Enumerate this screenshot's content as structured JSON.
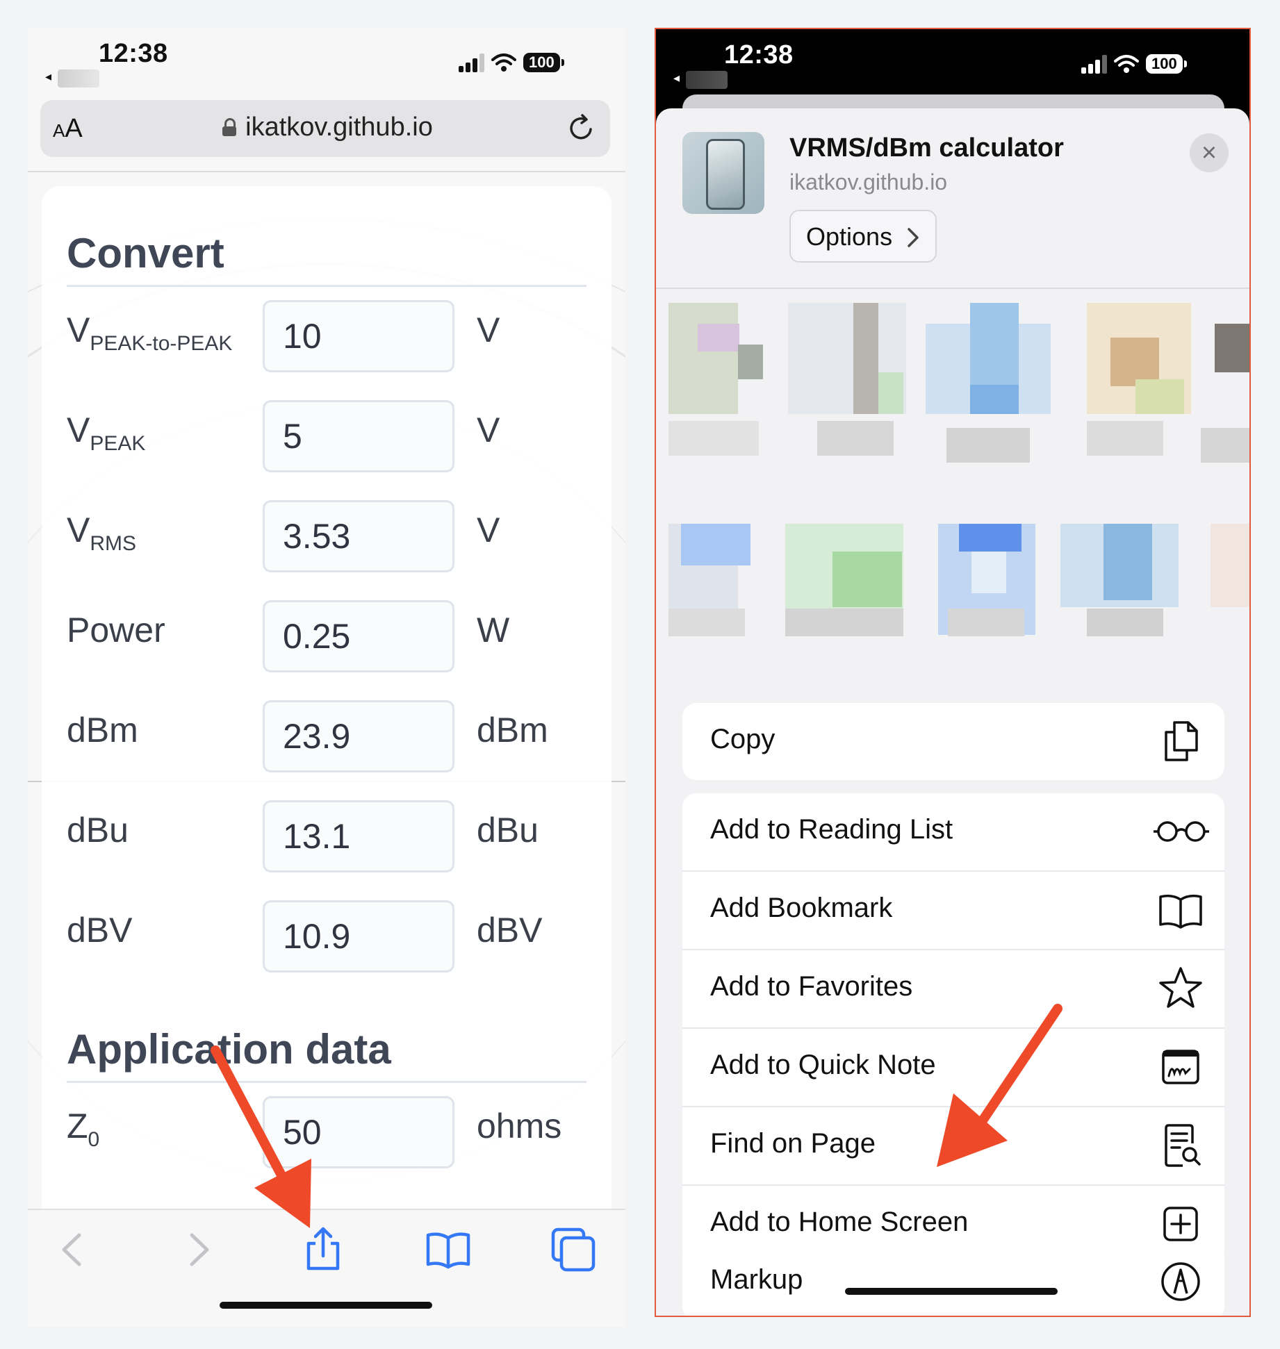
{
  "left": {
    "status": {
      "time": "12:38",
      "back_app": "◂",
      "battery": "100"
    },
    "url_bar": {
      "aa_big": "A",
      "aa_small": "A",
      "domain": "ikatkov.github.io"
    },
    "convert": {
      "heading": "Convert",
      "rows": [
        {
          "label_main": "V",
          "label_sub": "PEAK-to-PEAK",
          "value": "10",
          "unit": "V"
        },
        {
          "label_main": "V",
          "label_sub": "PEAK",
          "value": "5",
          "unit": "V"
        },
        {
          "label_main": "V",
          "label_sub": "RMS",
          "value": "3.53",
          "unit": "V"
        },
        {
          "label_main": "Power",
          "label_sub": "",
          "value": "0.25",
          "unit": "W"
        },
        {
          "label_main": "dBm",
          "label_sub": "",
          "value": "23.9",
          "unit": "dBm"
        },
        {
          "label_main": "dBu",
          "label_sub": "",
          "value": "13.1",
          "unit": "dBu"
        },
        {
          "label_main": "dBV",
          "label_sub": "",
          "value": "10.9",
          "unit": "dBV"
        }
      ]
    },
    "app_data": {
      "heading": "Application data",
      "rows": [
        {
          "label_main": "Z",
          "label_sub": "0",
          "value": "50",
          "unit": "ohms"
        }
      ]
    },
    "toolbar": [
      "back-icon",
      "forward-icon",
      "share-icon",
      "bookmarks-icon",
      "tabs-icon"
    ]
  },
  "right": {
    "status": {
      "time": "12:38",
      "back_app": "◂",
      "battery": "100"
    },
    "share_sheet": {
      "title": "VRMS/dBm calculator",
      "domain": "ikatkov.github.io",
      "options_label": "Options",
      "close_label": "×",
      "groups": [
        [
          {
            "label": "Copy",
            "icon": "copy-icon"
          }
        ],
        [
          {
            "label": "Add to Reading List",
            "icon": "glasses-icon"
          },
          {
            "label": "Add Bookmark",
            "icon": "book-icon"
          },
          {
            "label": "Add to Favorites",
            "icon": "star-icon"
          },
          {
            "label": "Add to Quick Note",
            "icon": "quick-note-icon"
          },
          {
            "label": "Find on Page",
            "icon": "find-on-page-icon"
          },
          {
            "label": "Add to Home Screen",
            "icon": "add-square-icon"
          }
        ],
        [
          {
            "label": "Markup",
            "icon": "markup-icon"
          }
        ]
      ]
    }
  },
  "colors": {
    "accent": "#3478f6",
    "annotation_arrow": "#ee4a2a",
    "frame_border": "#e05a3c"
  }
}
